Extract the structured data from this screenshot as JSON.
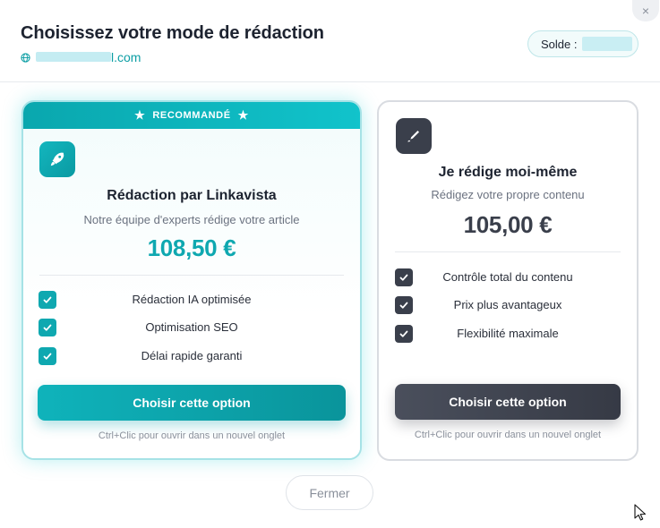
{
  "modal": {
    "title": "Choisissez votre mode de rédaction",
    "site_suffix": "l.com",
    "balance_label": "Solde :",
    "close_icon": "×"
  },
  "options": [
    {
      "badge": "RECOMMANDÉ",
      "icon": "rocket-icon",
      "title": "Rédaction par Linkavista",
      "subtitle": "Notre équipe d'experts rédige votre article",
      "price": "108,50 €",
      "features": [
        "Rédaction IA optimisée",
        "Optimisation SEO",
        "Délai rapide garanti"
      ],
      "cta": "Choisir cette option",
      "hint": "Ctrl+Clic pour ouvrir dans un nouvel onglet",
      "accent": "#0fa8b0"
    },
    {
      "icon": "pen-icon",
      "title": "Je rédige moi-même",
      "subtitle": "Rédigez votre propre contenu",
      "price": "105,00 €",
      "features": [
        "Contrôle total du contenu",
        "Prix plus avantageux",
        "Flexibilité maximale"
      ],
      "cta": "Choisir cette option",
      "hint": "Ctrl+Clic pour ouvrir dans un nouvel onglet",
      "accent": "#3a3f4b"
    }
  ],
  "footer": {
    "close_label": "Fermer"
  }
}
